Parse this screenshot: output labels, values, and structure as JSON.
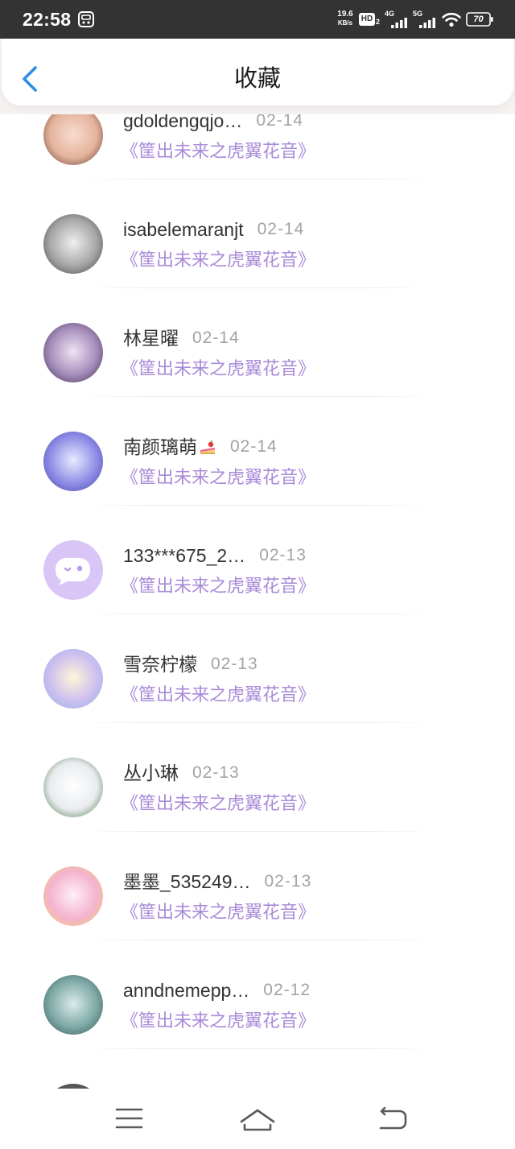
{
  "status_bar": {
    "background": "#333333",
    "time": "22:58",
    "notification_icon": "app-notification-icon",
    "net_speed_value": "19.6",
    "net_speed_unit": "KB/s",
    "hd_label": "HD",
    "hd_sub": "2",
    "network_1": "4G",
    "network_2": "5G",
    "wifi_icon": "wifi-icon",
    "battery_level": "70"
  },
  "header": {
    "back_icon": "chevron-left-icon",
    "title": "收藏",
    "accent_color": "#2b8fe3"
  },
  "favorites": {
    "subtitle_color": "#a98bd8",
    "items": [
      {
        "name": "gdoldengqjo…",
        "date": "02-14",
        "work": "《筐出未来之虎翼花音》",
        "avatar": {
          "type": "photo",
          "colors": [
            "#f7ddd0",
            "#e4b39c",
            "#5a342a"
          ]
        }
      },
      {
        "name": "isabelemaranjt",
        "date": "02-14",
        "work": "《筐出未来之虎翼花音》",
        "avatar": {
          "type": "photo",
          "colors": [
            "#f0f0f0",
            "#a6a6a6",
            "#3c3c3c"
          ]
        }
      },
      {
        "name": "林星曜",
        "date": "02-14",
        "work": "《筐出未来之虎翼花音》",
        "avatar": {
          "type": "photo",
          "colors": [
            "#efe4f2",
            "#a58dbb",
            "#3a2946"
          ]
        }
      },
      {
        "name": "南颜璃萌",
        "name_icon": "cake-icon",
        "date": "02-14",
        "work": "《筐出未来之虎翼花音》",
        "avatar": {
          "type": "photo",
          "colors": [
            "#e8ecff",
            "#8f8de6",
            "#3e43a8"
          ]
        }
      },
      {
        "name": "133***675_2…",
        "date": "02-13",
        "work": "《筐出未来之虎翼花音》",
        "avatar": {
          "type": "default",
          "background": "#d9c6f7",
          "icon": "chat-bubble-icon"
        }
      },
      {
        "name": "雪奈柠檬",
        "date": "02-13",
        "work": "《筐出未来之虎翼花音》",
        "avatar": {
          "type": "photo",
          "colors": [
            "#fff6d8",
            "#cdbff0",
            "#8bb3e2"
          ]
        }
      },
      {
        "name": "丛小琳",
        "date": "02-13",
        "work": "《筐出未来之虎翼花音》",
        "avatar": {
          "type": "photo",
          "colors": [
            "#ffffff",
            "#e9ecef",
            "#3d6b35"
          ]
        }
      },
      {
        "name": "墨墨_535249…",
        "date": "02-13",
        "work": "《筐出未来之虎翼花音》",
        "avatar": {
          "type": "photo",
          "colors": [
            "#fff0f6",
            "#f4b3cf",
            "#f0cf66"
          ]
        }
      },
      {
        "name": "anndnemepp…",
        "date": "02-12",
        "work": "《筐出未来之虎翼花音》",
        "avatar": {
          "type": "photo",
          "colors": [
            "#dbeceb",
            "#7ea9a5",
            "#2f5150"
          ]
        }
      },
      {
        "avatar": {
          "type": "photo",
          "colors": [
            "#9a9a9a",
            "#5e5e5e",
            "#2f2f2f"
          ]
        }
      }
    ]
  },
  "nav_bar": {
    "menu_icon": "menu-icon",
    "home_icon": "home-icon",
    "back_icon": "return-icon"
  }
}
